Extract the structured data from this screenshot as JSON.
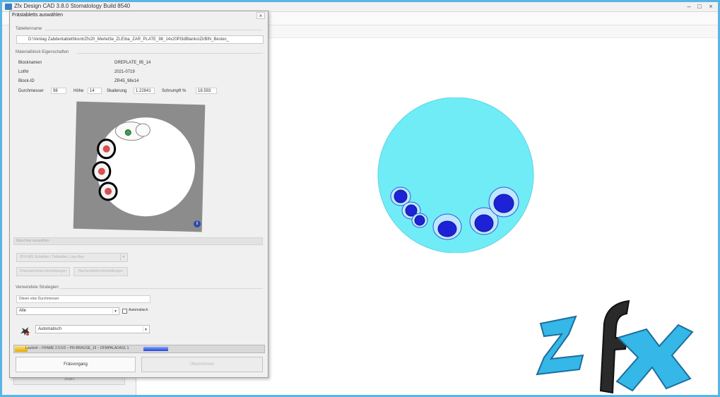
{
  "window": {
    "title": "Zfx Design CAD 3.8.0 Stomatology Build 8540"
  },
  "dialog": {
    "title": "Frästabletts auswählen",
    "file_section_label": "Tabellenname",
    "file_path": "D:\\Venlag Zabdentablett\\kontrZfx20_Merlet3e_ZLE\\ba_ZAR_PLATE_98_14x20Pl3dBlanks\\ZirBlN_Bestec_",
    "props_section_label": "Materialblock-Eigenschaften",
    "rows": [
      {
        "label": "Blocknamen",
        "value": "DREPLATE_95_14"
      },
      {
        "label": "LotNr",
        "value": "2021-0719"
      },
      {
        "label": "Block-ID",
        "value": "ZR45_98x14"
      }
    ],
    "dims": {
      "diameter_label": "Durchmesser",
      "diameter_value": "98",
      "height_label": "Höhe",
      "height_value": "14",
      "scale_label": "Skalierung",
      "scale_value": "1.22841",
      "shrink_label": "Schrumpft %",
      "shrink_value": "18.593"
    },
    "machine_section_label": "Maschine auswählen",
    "machine_select": "ZFX-NIS Schleifen | Tiefstellen, Low-Res",
    "machine_btn_1": "Fräsmaschinen-Einstellungen",
    "machine_btn_2": "Nachschleifen-Einstellungen",
    "strategy_section_label": "Verwendete Strategien",
    "strategy_box": "Dieser eine Durchmesser",
    "strategy_select": "Alle",
    "checkbox_label": "Automatisch",
    "mode_select": "Automatisch",
    "progress_text": "Laufzeit – FRAME 2.0.5/2 – PR-BRAUSE_19 – DFMPALADAS1.1",
    "progress_value": 0.05,
    "progress_secondary_value": 0.1,
    "btn_primary": "Fräsvorgang",
    "btn_secondary": "Übernehmen",
    "info_icon": "i"
  },
  "background": {
    "side_button": "Start"
  },
  "colors": {
    "frame": "#5ab4e6",
    "puck": "#70ecf7",
    "parts": "#1d22d6",
    "logo_blue": "#35b7e8"
  }
}
